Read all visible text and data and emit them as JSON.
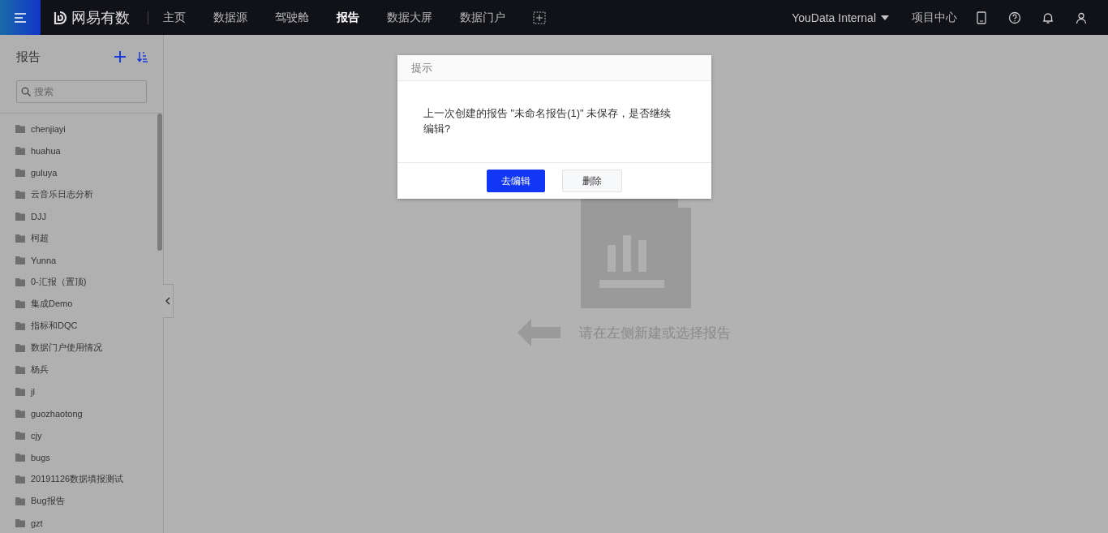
{
  "topbar": {
    "brand": "网易有数",
    "nav": [
      {
        "label": "主页",
        "selected": false
      },
      {
        "label": "数据源",
        "selected": false
      },
      {
        "label": "驾驶舱",
        "selected": false
      },
      {
        "label": "报告",
        "selected": true
      },
      {
        "label": "数据大屏",
        "selected": false
      },
      {
        "label": "数据门户",
        "selected": false
      }
    ],
    "org": "YouData Internal",
    "project_center": "项目中心"
  },
  "sidebar": {
    "title": "报告",
    "search": {
      "placeholder": "搜索"
    },
    "items": [
      "chenjiayi",
      "huahua",
      "guluya",
      "云音乐日志分析",
      "DJJ",
      "柯超",
      "Yunna",
      "0-汇报（置顶)",
      "集成Demo",
      "指标和DQC",
      "数据门户使用情况",
      "杨兵",
      "jl",
      "guozhaotong",
      "cjy",
      "bugs",
      "20191126数据填报测试",
      "Bug报告",
      "gzt"
    ]
  },
  "empty_state": {
    "message": "请在左侧新建或选择报告"
  },
  "dialog": {
    "title": "提示",
    "message": "上一次创建的报告 \"未命名报告(1)\" 未保存，是否继续编辑?",
    "buttons": [
      {
        "label": "去编辑",
        "kind": "primary"
      },
      {
        "label": "删除",
        "kind": "default"
      }
    ]
  }
}
